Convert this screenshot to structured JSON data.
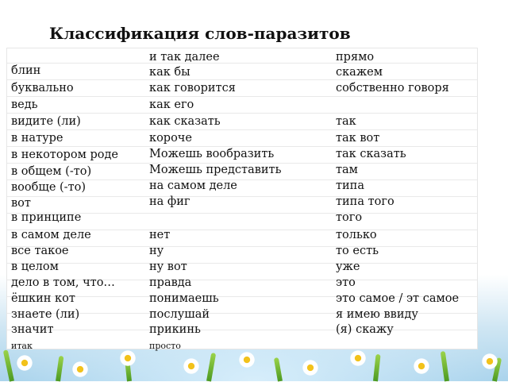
{
  "title": "Классификация слов-паразитов",
  "columns": {
    "left": [
      "блин",
      "буквально",
      "ведь",
      "видите (ли)",
      "в натуре",
      "в некотором роде",
      "в общем (-то)",
      "вообще (-то)",
      "вот",
      "в принципе",
      "в самом деле",
      "все такое",
      "в целом",
      "дело в том, что…",
      "ёшкин кот",
      "знаете (ли)",
      "значит",
      "итак"
    ],
    "middle": [
      "и так далее",
      "как бы",
      "как говорится",
      "как его",
      "как сказать",
      "короче",
      "Можешь  вообразить",
      "Можешь  представить",
      "на самом деле",
      "на фиг",
      "нет",
      "ну",
      "ну вот",
      "правда",
      "понимаешь",
      "послушай",
      "прикинь",
      "просто"
    ],
    "right": [
      "прямо",
      "скажем",
      "собственно говоря",
      "так",
      "так вот",
      "так сказать",
      "там",
      "типа",
      "типа того",
      "того",
      "только",
      "то есть",
      "уже",
      "это",
      "это самое / эт самое",
      "я имею ввиду",
      "(я) скажу"
    ]
  }
}
